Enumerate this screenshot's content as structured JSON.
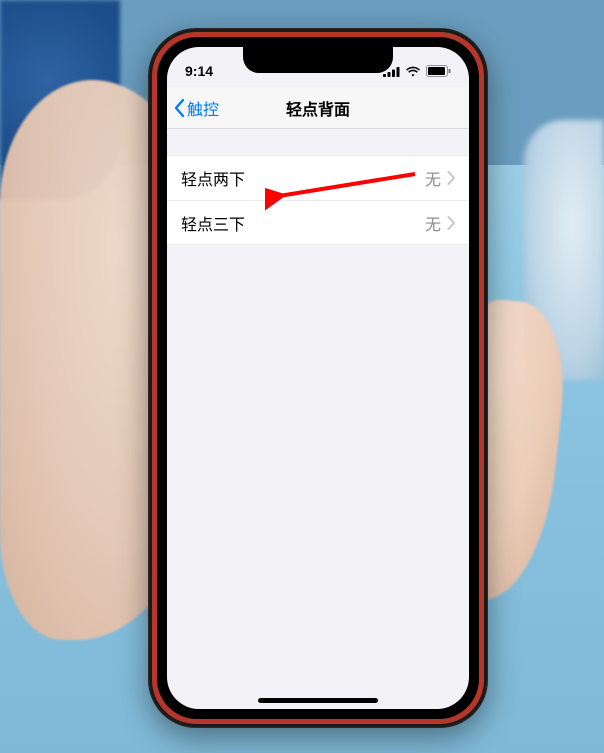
{
  "statusbar": {
    "time": "9:14"
  },
  "nav": {
    "back_label": "触控",
    "title": "轻点背面"
  },
  "rows": [
    {
      "label": "轻点两下",
      "value": "无"
    },
    {
      "label": "轻点三下",
      "value": "无"
    }
  ]
}
